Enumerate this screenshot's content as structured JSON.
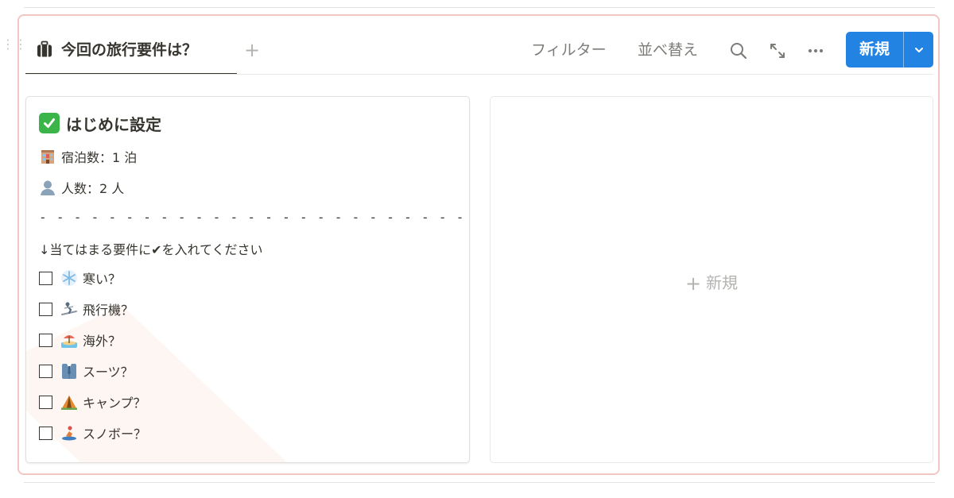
{
  "colors": {
    "accent": "#2383e2",
    "frame": "#f2c6c2",
    "text": "#37352f",
    "muted": "#7d7c78"
  },
  "tabs": [
    {
      "label": "今回の旅行要件は？",
      "icon": "luggage-icon",
      "active": true
    }
  ],
  "toolbar": {
    "add_tab_label": "+",
    "filter_label": "フィルター",
    "sort_label": "並べ替え",
    "search_icon": "search-icon",
    "expand_icon": "expand-icon",
    "more_icon": "more-icon",
    "new_label": "新規",
    "new_caret_icon": "chevron-down-icon"
  },
  "card": {
    "title_icon": "check-mark-emoji",
    "title": "はじめに設定",
    "nights": {
      "icon": "hotel-emoji",
      "text": "宿泊数：1 泊"
    },
    "people": {
      "icon": "person-emoji",
      "text": "人数：2 人"
    },
    "divider": "- - - - - - - - - - - - - - - - - - - - - - - - - -",
    "instruction": "↓当てはまる要件に✔︎を入れてください",
    "checklist": [
      {
        "icon": "snowflake-emoji",
        "label": "寒い？",
        "checked": false
      },
      {
        "icon": "skier-emoji",
        "label": "飛行機？",
        "checked": false
      },
      {
        "icon": "beach-emoji",
        "label": "海外？",
        "checked": false
      },
      {
        "icon": "suit-emoji",
        "label": "スーツ？",
        "checked": false
      },
      {
        "icon": "tent-emoji",
        "label": "キャンプ？",
        "checked": false
      },
      {
        "icon": "snowboarder-emoji",
        "label": "スノボー？",
        "checked": false
      }
    ]
  },
  "empty_column": {
    "new_label": "新規"
  }
}
